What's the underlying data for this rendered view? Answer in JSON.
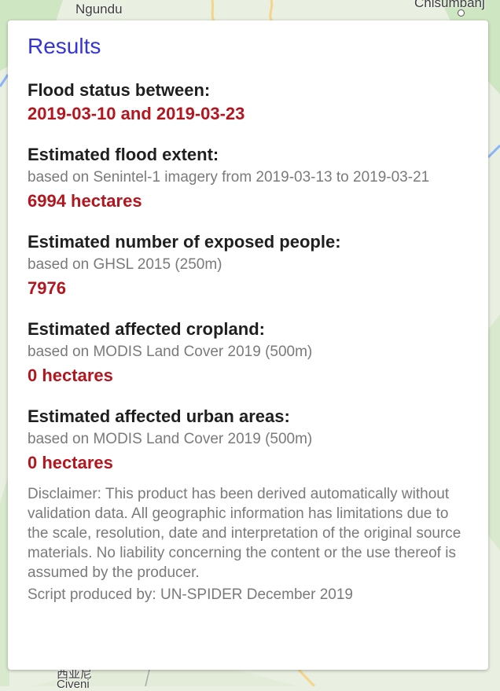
{
  "map": {
    "labels": {
      "top_left": "Ngundu",
      "top_right": "Chisumbanj",
      "bottom_left": "Civeni",
      "bottom_left_cjk": "西亚尼"
    }
  },
  "results": {
    "title": "Results",
    "flood_status": {
      "heading": "Flood status between:",
      "value": "2019-03-10 and 2019-03-23"
    },
    "flood_extent": {
      "heading": "Estimated flood extent:",
      "source": "based on Senintel-1 imagery from 2019-03-13 to 2019-03-21",
      "value": "6994 hectares"
    },
    "exposed_people": {
      "heading": "Estimated number of exposed people:",
      "source": "based on GHSL 2015 (250m)",
      "value": "7976"
    },
    "cropland": {
      "heading": "Estimated affected cropland:",
      "source": "based on MODIS Land Cover 2019 (500m)",
      "value": "0 hectares"
    },
    "urban_areas": {
      "heading": "Estimated affected urban areas:",
      "source": "based on MODIS Land Cover 2019 (500m)",
      "value": "0 hectares"
    },
    "disclaimer": "Disclaimer: This product has been derived automatically without validation data. All geographic information has limitations due to the scale, resolution, date and interpretation of the original source materials. No liability concerning the content or the use thereof is assumed by the producer.",
    "credit": "Script produced by: UN-SPIDER December 2019"
  },
  "colors": {
    "title": "#3434d8",
    "value": "#b3161f",
    "heading": "#1f1f1f",
    "muted": "#7a7a7a",
    "map_land": "#e9efe1",
    "map_green": "#cfe6c3",
    "map_road": "#f4d58a"
  }
}
